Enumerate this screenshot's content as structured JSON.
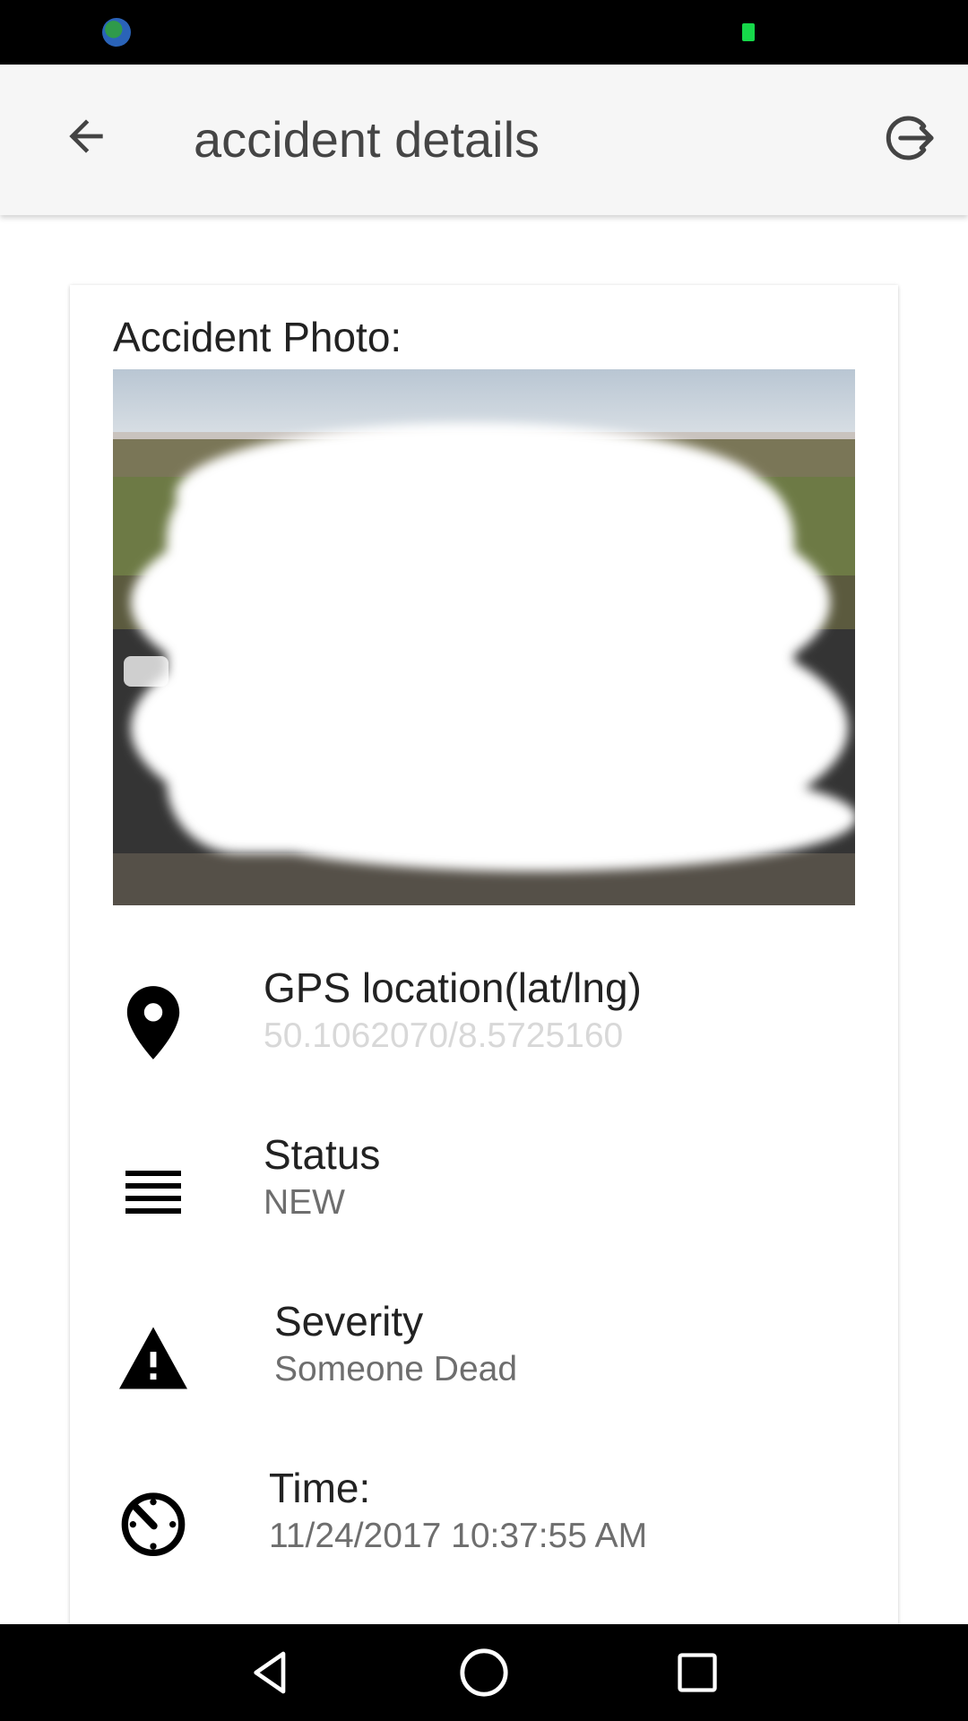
{
  "app_bar": {
    "title": "accident details"
  },
  "card": {
    "photo_label": "Accident Photo:",
    "rows": [
      {
        "icon": "location-pin-icon",
        "title": "GPS location(lat/lng)",
        "value": "50.1062070/8.5725160"
      },
      {
        "icon": "list-lines-icon",
        "title": "Status",
        "value": "NEW"
      },
      {
        "icon": "warning-triangle-icon",
        "title": "Severity",
        "value": "Someone Dead"
      },
      {
        "icon": "timer-icon",
        "title": "Time:",
        "value": "11/24/2017 10:37:55 AM"
      }
    ]
  },
  "colors": {
    "status_bar": "#000000",
    "app_bar": "#f6f6f6",
    "battery": "#16d84a",
    "value_text": "#6e6e6e"
  }
}
